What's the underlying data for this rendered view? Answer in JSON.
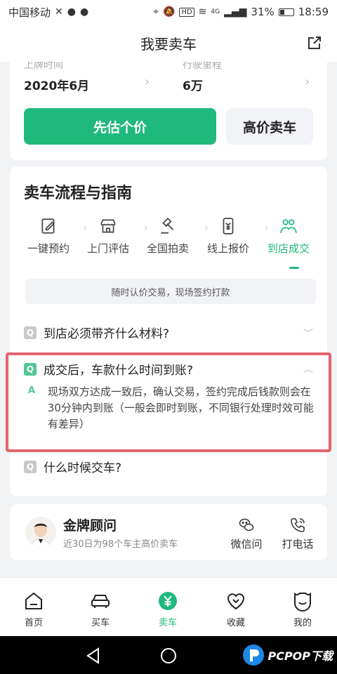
{
  "status_bar": {
    "carrier": "中国移动",
    "network": "4G",
    "hd": "HD",
    "battery": "31%",
    "time": "18:59"
  },
  "nav": {
    "title": "我要卖车"
  },
  "car_info": {
    "plate_time_label": "上牌时间",
    "plate_time_value": "2020年6月",
    "mileage_label": "行驶里程",
    "mileage_value": "6万",
    "estimate_button": "先估个价",
    "sell_button": "高价卖车"
  },
  "process": {
    "title": "卖车流程与指南",
    "steps": [
      {
        "label": "一键预约",
        "icon": "edit-icon"
      },
      {
        "label": "上门评估",
        "icon": "store-icon"
      },
      {
        "label": "全国拍卖",
        "icon": "gavel-icon"
      },
      {
        "label": "线上报价",
        "icon": "yuan-phone-icon"
      },
      {
        "label": "到店成交",
        "icon": "handshake-icon"
      }
    ],
    "active_step": 4,
    "tip": "随时认价交易，现场签约打款",
    "faq": [
      {
        "badge": "Q",
        "question": "到店必须带齐什么材料?"
      },
      {
        "badge": "Q",
        "question": "成交后，车款什么时间到账?",
        "answer_badge": "A",
        "answer": "现场双方达成一致后，确认交易，签约完成后钱款则会在30分钟内到账（一般会即时到账，不同银行处理时效可能有差异）"
      },
      {
        "badge": "Q",
        "question": "什么时候交车?"
      }
    ]
  },
  "advisor": {
    "name": "金牌顾问",
    "subtitle": "近30日为98个车主高价卖车",
    "wechat_label": "微信问",
    "call_label": "打电话"
  },
  "tabs": [
    {
      "label": "首页",
      "icon": "home-icon"
    },
    {
      "label": "买车",
      "icon": "car-icon"
    },
    {
      "label": "卖车",
      "icon": "yuan-icon"
    },
    {
      "label": "收藏",
      "icon": "heart-icon"
    },
    {
      "label": "我的",
      "icon": "profile-icon"
    }
  ],
  "watermark": "PCPOP下载",
  "colors": {
    "accent": "#20b97d",
    "highlight": "#e4646e"
  }
}
